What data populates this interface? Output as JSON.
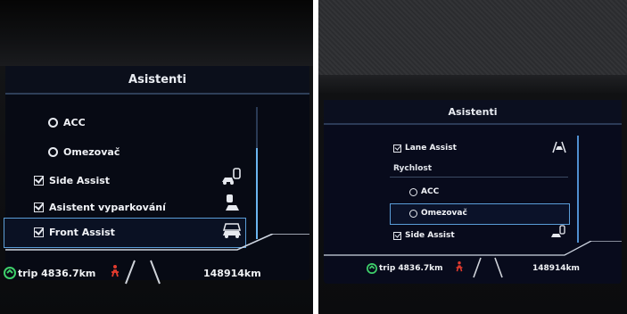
{
  "left_photo": {
    "screen_title": "Asistenti",
    "menu": [
      {
        "type": "radio",
        "label": "ACC",
        "selected": false
      },
      {
        "type": "radio",
        "label": "Omezovač",
        "selected": false
      },
      {
        "type": "checkbox",
        "label": "Side Assist",
        "selected": false,
        "icon": "side-assist-icon"
      },
      {
        "type": "checkbox",
        "label": "Asistent vyparkování",
        "selected": false,
        "icon": "exit-warning-icon"
      },
      {
        "type": "checkbox",
        "label": "Front Assist",
        "selected": true,
        "icon": "front-assist-icon"
      }
    ],
    "status": {
      "trip": "trip 4836.7km",
      "odometer": "148914km"
    }
  },
  "right_photo": {
    "screen_title": "Asistenti",
    "menu": [
      {
        "type": "checkbox",
        "label": "Lane Assist",
        "selected": false,
        "icon": "lane-assist-icon"
      },
      {
        "type": "header",
        "label": "Rychlost"
      },
      {
        "type": "radio",
        "label": "ACC",
        "selected": false
      },
      {
        "type": "radio",
        "label": "Omezovač",
        "selected": true
      },
      {
        "type": "checkbox",
        "label": "Side Assist",
        "selected": false,
        "icon": "side-assist-icon"
      }
    ],
    "status": {
      "trip": "trip 4836.7km",
      "odometer": "148914km"
    }
  },
  "colors": {
    "highlight": "#5a9dd8",
    "eco_green": "#3ecf6a",
    "warning_red": "#e23b2e",
    "text": "#f1f3f7"
  }
}
